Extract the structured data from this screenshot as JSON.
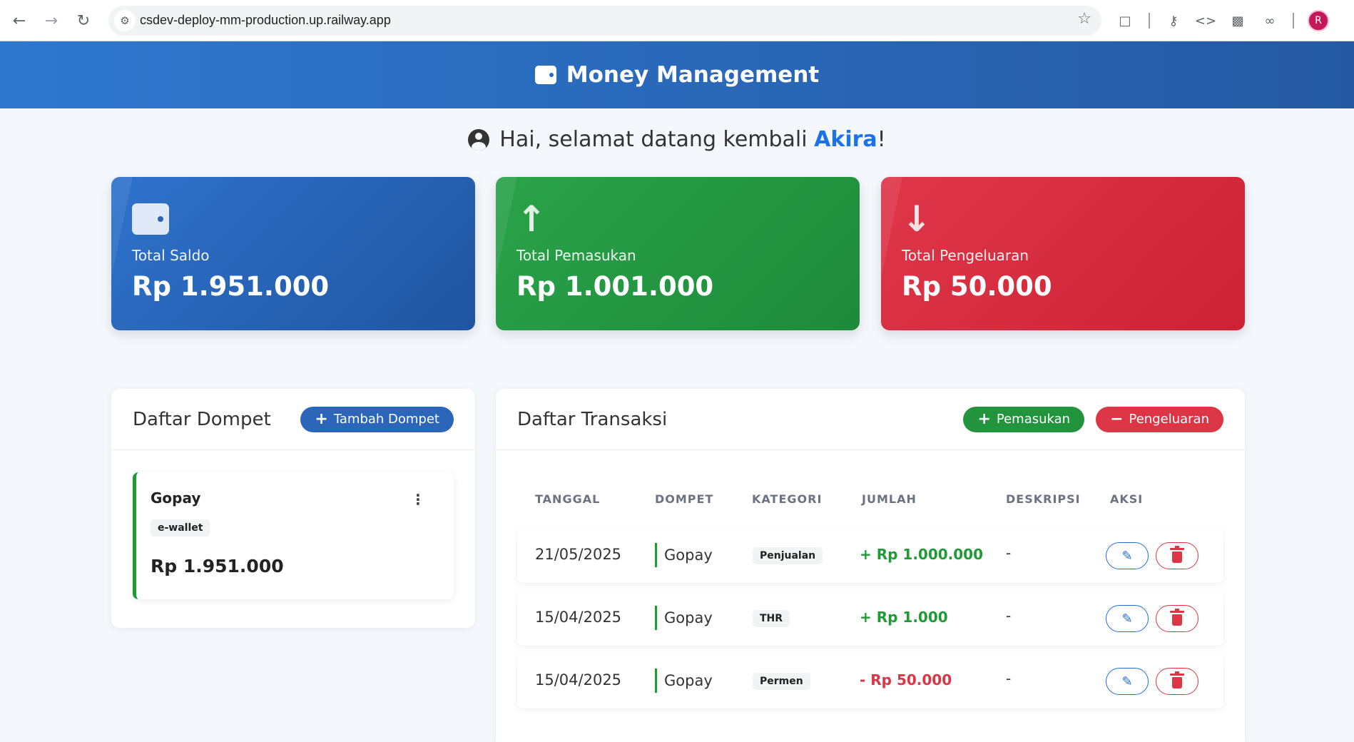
{
  "browser": {
    "url": "csdev-deploy-mm-production.up.railway.app",
    "profile_initial": "R"
  },
  "app": {
    "title": "Money Management"
  },
  "greeting": {
    "prefix": "Hai, selamat datang kembali ",
    "name": "Akira",
    "suffix": "!"
  },
  "stats": [
    {
      "label": "Total Saldo",
      "value": "Rp 1.951.000",
      "icon": "wallet-icon",
      "color": "#2b66b8"
    },
    {
      "label": "Total Pemasukan",
      "value": "Rp 1.001.000",
      "icon": "arrow-up-icon",
      "color": "#22943e"
    },
    {
      "label": "Total Pengeluaran",
      "value": "Rp 50.000",
      "icon": "arrow-down-icon",
      "color": "#dc3545"
    }
  ],
  "wallets_panel": {
    "title": "Daftar Dompet",
    "add_label": "Tambah Dompet",
    "wallets": [
      {
        "name": "Gopay",
        "type": "e-wallet",
        "balance": "Rp 1.951.000"
      }
    ]
  },
  "transactions_panel": {
    "title": "Daftar Transaksi",
    "income_label": "Pemasukan",
    "expense_label": "Pengeluaran",
    "columns": [
      "TANGGAL",
      "DOMPET",
      "KATEGORI",
      "JUMLAH",
      "DESKRIPSI",
      "AKSI"
    ],
    "rows": [
      {
        "date": "21/05/2025",
        "wallet": "Gopay",
        "category": "Penjualan",
        "amount": "+ Rp 1.000.000",
        "kind": "income",
        "description": "-"
      },
      {
        "date": "15/04/2025",
        "wallet": "Gopay",
        "category": "THR",
        "amount": "+ Rp 1.000",
        "kind": "income",
        "description": "-"
      },
      {
        "date": "15/04/2025",
        "wallet": "Gopay",
        "category": "Permen",
        "amount": "- Rp 50.000",
        "kind": "expense",
        "description": "-"
      }
    ]
  }
}
